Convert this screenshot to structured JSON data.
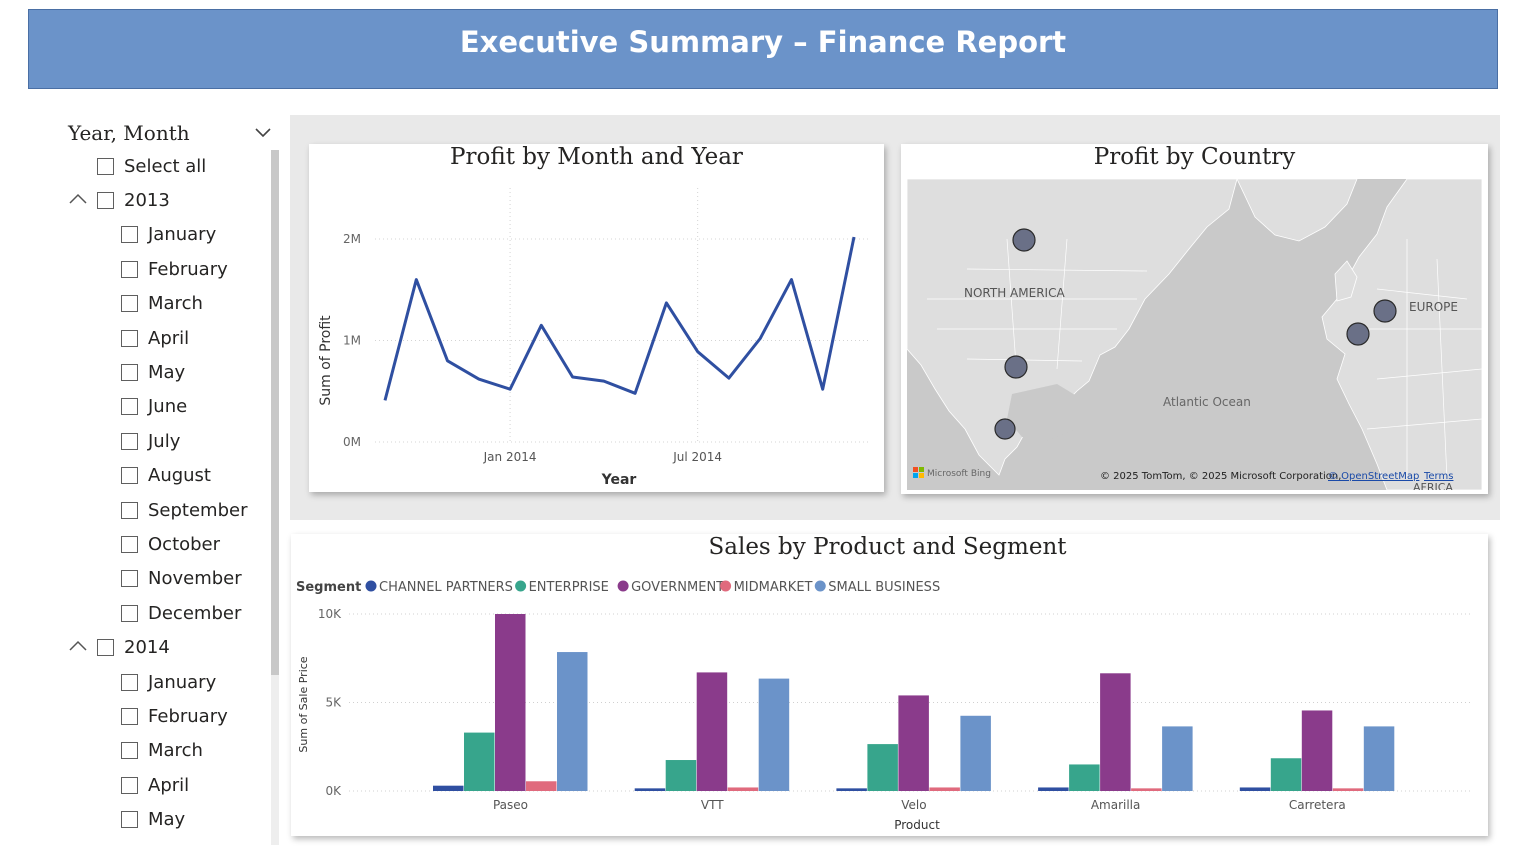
{
  "header": {
    "title": "Executive Summary – Finance Report"
  },
  "slicer": {
    "title": "Year, Month",
    "select_all": "Select all",
    "visible_rows": [
      {
        "label": "2013",
        "type": "year"
      },
      {
        "label": "January",
        "type": "month"
      },
      {
        "label": "February",
        "type": "month"
      },
      {
        "label": "March",
        "type": "month"
      },
      {
        "label": "April",
        "type": "month"
      },
      {
        "label": "May",
        "type": "month"
      },
      {
        "label": "June",
        "type": "month"
      },
      {
        "label": "July",
        "type": "month"
      },
      {
        "label": "August",
        "type": "month"
      },
      {
        "label": "September",
        "type": "month"
      },
      {
        "label": "October",
        "type": "month"
      },
      {
        "label": "November",
        "type": "month"
      },
      {
        "label": "December",
        "type": "month"
      },
      {
        "label": "2014",
        "type": "year"
      },
      {
        "label": "January",
        "type": "month"
      },
      {
        "label": "February",
        "type": "month"
      },
      {
        "label": "March",
        "type": "month"
      },
      {
        "label": "April",
        "type": "month"
      },
      {
        "label": "May",
        "type": "month"
      }
    ]
  },
  "map": {
    "title": "Profit by Country",
    "labels": {
      "north_america": "NORTH AMERICA",
      "europe": "EUROPE",
      "ocean": "Atlantic Ocean",
      "africa": "AFRICA",
      "attribution": "© 2025 TomTom, © 2025 Microsoft Corporation,",
      "osm": "© OpenStreetMap",
      "terms": "Terms",
      "logo": "Microsoft Bing"
    },
    "colors": {
      "bubble": "#6a7087",
      "land": "#d9d9d9",
      "water": "#c6c6c6"
    }
  },
  "chart_data": [
    {
      "type": "line",
      "title": "Profit by Month and Year",
      "xlabel": "Year",
      "ylabel": "Sum of Profit",
      "x_tick_labels": [
        "Jan 2014",
        "Jul 2014"
      ],
      "y_tick_labels": [
        "0M",
        "1M",
        "2M"
      ],
      "ylim": [
        0,
        2000000
      ],
      "grid": true,
      "color": "#2f4fa1",
      "x": [
        "2013-09",
        "2013-10",
        "2013-11",
        "2013-12",
        "2014-01",
        "2014-02",
        "2014-03",
        "2014-04",
        "2014-05",
        "2014-06",
        "2014-07",
        "2014-08",
        "2014-09",
        "2014-10",
        "2014-11",
        "2014-12"
      ],
      "values": [
        410000,
        1600000,
        800000,
        620000,
        520000,
        1150000,
        640000,
        600000,
        480000,
        1370000,
        890000,
        630000,
        1020000,
        1600000,
        520000,
        2020000
      ]
    },
    {
      "type": "bar",
      "title": "Sales by Product and Segment",
      "xlabel": "Product",
      "ylabel": "Sum of Sale Price",
      "legend_title": "Segment",
      "legend_position": "top-left",
      "y_tick_labels": [
        "0K",
        "5K",
        "10K"
      ],
      "ylim": [
        0,
        10000
      ],
      "grid": true,
      "categories": [
        "Paseo",
        "VTT",
        "Velo",
        "Amarilla",
        "Carretera"
      ],
      "series": [
        {
          "name": "CHANNEL PARTNERS",
          "color": "#2f4fa1",
          "values": [
            300,
            150,
            150,
            200,
            200
          ]
        },
        {
          "name": "ENTERPRISE",
          "color": "#37a58c",
          "values": [
            3300,
            1750,
            2650,
            1500,
            1850
          ]
        },
        {
          "name": "GOVERNMENT",
          "color": "#8a3b8b",
          "values": [
            10000,
            6700,
            5400,
            6650,
            4550
          ]
        },
        {
          "name": "MIDMARKET",
          "color": "#e06a7d",
          "values": [
            550,
            200,
            200,
            150,
            150
          ]
        },
        {
          "name": "SMALL BUSINESS",
          "color": "#6b93c9",
          "values": [
            7850,
            6350,
            4250,
            3650,
            3650
          ]
        }
      ]
    }
  ]
}
